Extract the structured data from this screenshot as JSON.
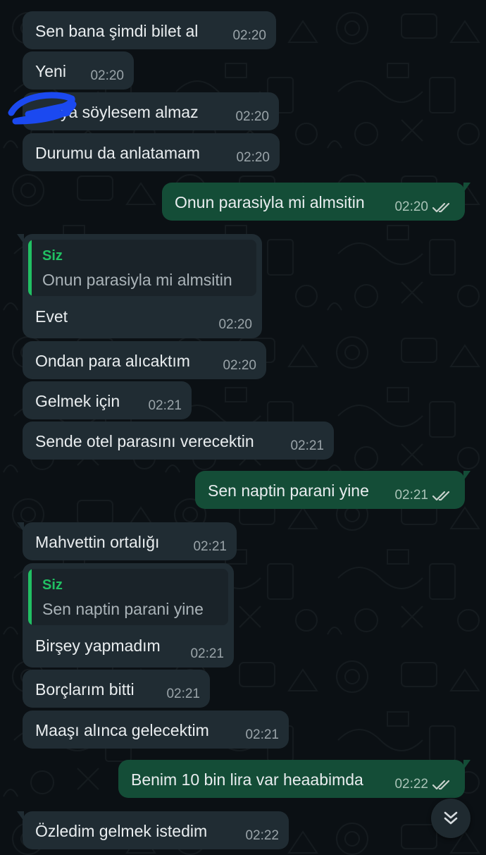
{
  "conversation": {
    "messages": [
      {
        "text": "Sen bana şimdi bilet al",
        "time": "02:20",
        "direction": "in"
      },
      {
        "text": "Yeni",
        "time": "02:20",
        "direction": "in"
      },
      {
        "text": "Anneme söylesem almaz",
        "visible_text": "ya söylesem almaz",
        "time": "02:20",
        "direction": "in"
      },
      {
        "text": "Durumu da anlatamam",
        "time": "02:20",
        "direction": "in"
      },
      {
        "text": "Onun parasiyla mi almsitin",
        "time": "02:20",
        "direction": "out",
        "status": "read"
      },
      {
        "text": "Evet",
        "time": "02:20",
        "direction": "in",
        "reply_to": {
          "author": "Siz",
          "text": "Onun parasiyla mi almsitin"
        }
      },
      {
        "text": "Ondan para alıcaktım",
        "time": "02:20",
        "direction": "in"
      },
      {
        "text": "Gelmek için",
        "time": "02:21",
        "direction": "in"
      },
      {
        "text": "Sende otel parasını verecektin",
        "time": "02:21",
        "direction": "in"
      },
      {
        "text": "Sen naptin parani yine",
        "time": "02:21",
        "direction": "out",
        "status": "read"
      },
      {
        "text": "Mahvettin ortalığı",
        "time": "02:21",
        "direction": "in"
      },
      {
        "text": "Birşey yapmadım",
        "time": "02:21",
        "direction": "in",
        "reply_to": {
          "author": "Siz",
          "text": "Sen naptin parani yine"
        }
      },
      {
        "text": "Borçlarım bitti",
        "time": "02:21",
        "direction": "in"
      },
      {
        "text": "Maaşı alınca gelecektim",
        "time": "02:21",
        "direction": "in"
      },
      {
        "text": "Benim 10 bin lira var heaabimda",
        "time": "02:22",
        "direction": "out",
        "status": "read"
      },
      {
        "text": "Özledim gelmek istedim",
        "time": "02:22",
        "direction": "in"
      }
    ]
  },
  "colors": {
    "background": "#0b1014",
    "incoming_bubble": "#202c33",
    "outgoing_bubble": "#144d37",
    "quote_accent": "#21c063",
    "read_ticks": "#c8d1cc",
    "redaction_scribble": "#1b49f0"
  },
  "icons": {
    "read_receipt": "double-check-icon",
    "scroll_down": "double-chevron-down-icon"
  }
}
